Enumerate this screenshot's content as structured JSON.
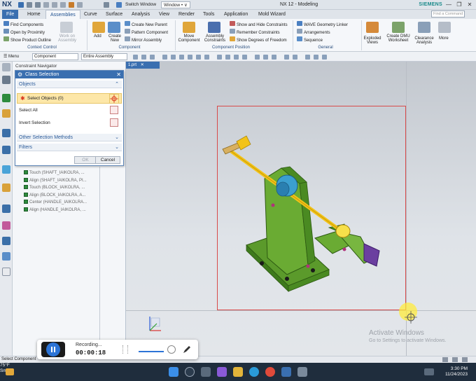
{
  "app": {
    "logo": "NX",
    "title": "NX 12 - Modeling",
    "brand": "SIEMENS",
    "switch_window": "Switch Window",
    "window_menu": "Window • ∨",
    "find_command_placeholder": "Find a Command"
  },
  "tabs": [
    "File",
    "Home",
    "Assemblies",
    "Curve",
    "Surface",
    "Analysis",
    "View",
    "Render",
    "Tools",
    "Application",
    "Mold Wizard"
  ],
  "ribbon": {
    "context_control": {
      "items": [
        "Find Components",
        "Open by Proximity",
        "Show Product Outline"
      ],
      "work_on_assembly": "Work on Assembly",
      "label": "Context Control"
    },
    "component": {
      "add": "Add",
      "create_new": "Create New",
      "items": [
        "Create New Parent",
        "Pattern Component",
        "Mirror Assembly"
      ],
      "label": "Component"
    },
    "component_position": {
      "move": "Move Component",
      "constraints": "Assembly Constraints",
      "items": [
        "Show and Hide Constraints",
        "Remember Constraints",
        "Show Degrees of Freedom"
      ],
      "label": "Component Position"
    },
    "general": {
      "items": [
        "WAVE Geometry Linker",
        "Arrangements",
        "Sequence"
      ],
      "label": "General"
    },
    "exploded_views": "Exploded Views",
    "dmu": "Create DMU Worksheet",
    "clearance": "Clearance Analysis",
    "more": "More"
  },
  "selection_bar": {
    "menu": "Menu",
    "filter": "Component",
    "scope": "Entire Assembly"
  },
  "navigator": {
    "title": "Constraint Navigator",
    "rows": [
      "Touch (SHAFT_IAIKOLRA, ...",
      "Align (SHAFT_IAIKOLRA, PI...",
      "Touch (BLOCK_IAIKOLRA, ...",
      "Align (BLOCK_IAIKOLRA, A...",
      "Center (HANDLE_IAIKOLRA...",
      "Align (HANDLE_IAIKOLRA, ..."
    ]
  },
  "dialog": {
    "title": "Class Selection",
    "objects_section": "Objects",
    "select_objects": "Select Objects (0)",
    "select_all": "Select All",
    "invert_selection": "Invert Selection",
    "other_methods": "Other Selection Methods",
    "filters": "Filters",
    "ok": "OK",
    "cancel": "Cancel"
  },
  "viewport": {
    "tab": "1.prt",
    "watermark_title": "Activate Windows",
    "watermark_sub": "Go to Settings to activate Windows."
  },
  "status": {
    "text": "Select Component"
  },
  "recording": {
    "label": "Recording...",
    "time": "00:00:18"
  },
  "taskbar": {
    "temp": "75°F",
    "weather": "Smoke",
    "time": "3:30 PM",
    "date": "11/24/2023"
  },
  "colors": {
    "accent": "#3a6fb0",
    "model_green": "#5b9a2b",
    "model_yellow": "#f2c318",
    "model_blue": "#3b9fd0",
    "model_purple": "#6b3fa0"
  }
}
